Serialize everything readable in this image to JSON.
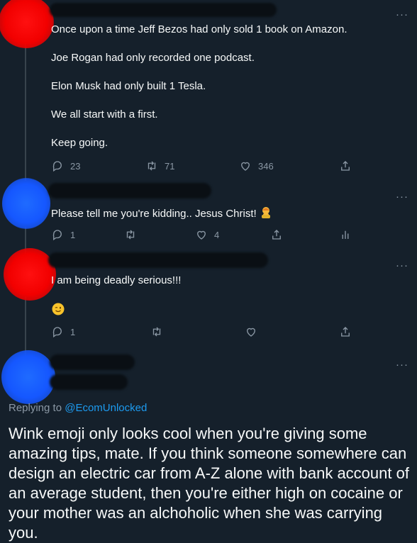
{
  "tweets": [
    {
      "lines": [
        "Once upon a time Jeff Bezos had only sold 1 book on Amazon.",
        "Joe Rogan had only recorded one podcast.",
        "Elon Musk had only built 1 Tesla.",
        "We all start with a first.",
        "Keep going."
      ],
      "replies": "23",
      "retweets": "71",
      "likes": "346"
    },
    {
      "text": "Please tell me you're kidding.. Jesus Christ!",
      "replies": "1",
      "likes": "4"
    },
    {
      "text": "I am being deadly serious!!!",
      "replies": "1"
    }
  ],
  "reply": {
    "prefix": "Replying to",
    "mention": "@EcomUnlocked",
    "text": "Wink emoji only looks cool when you're giving some amazing tips, mate. If you think someone somewhere can design an electric car from A-Z alone with bank account of an average student, then you're either high on cocaine or your mother was an alchoholic when she was carrying you."
  },
  "more_glyph": "···",
  "colors": {
    "background": "#15202b",
    "text": "#f7f9f9",
    "muted": "#8b98a5",
    "link": "#1d9bf0",
    "thread_line": "#38444d"
  },
  "icons": [
    "reply-icon",
    "retweet-icon",
    "like-icon",
    "share-icon",
    "analytics-icon",
    "more-icon",
    "facepalm-emoji",
    "wink-emoji"
  ]
}
